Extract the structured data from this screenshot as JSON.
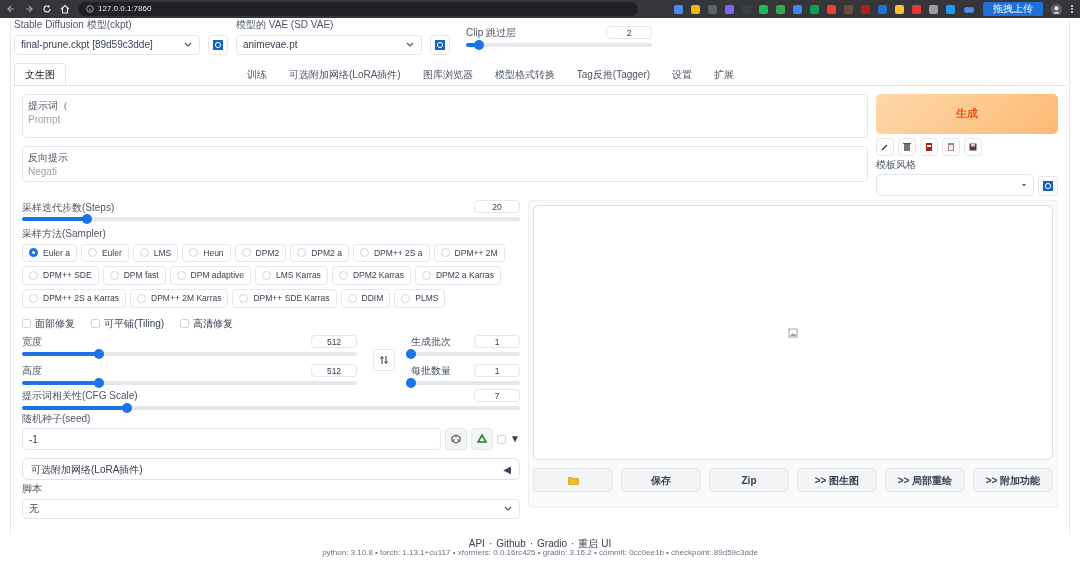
{
  "browser": {
    "address": "127.0.0.1:7860",
    "upload_button": "拖拽上传"
  },
  "top_settings": {
    "checkpoint": {
      "label": "Stable Diffusion 模型(ckpt)",
      "value": "final-prune.ckpt [89d59c3dde]"
    },
    "vae": {
      "label": "模型的 VAE (SD VAE)",
      "value": "animevae.pt"
    },
    "clip": {
      "label": "Clip 跳过层",
      "value": "2",
      "level": 0.07
    }
  },
  "tabs": [
    {
      "label": "文生图",
      "selected": true
    },
    {
      "label": "训练",
      "selected": false
    },
    {
      "label": "可选附加网络(LoRA插件)",
      "selected": false
    },
    {
      "label": "图库浏览器",
      "selected": false
    },
    {
      "label": "模型格式转换",
      "selected": false
    },
    {
      "label": "Tag反推(Tagger)",
      "selected": false
    },
    {
      "label": "设置",
      "selected": false
    },
    {
      "label": "扩展",
      "selected": false
    }
  ],
  "prompt": {
    "label": "提示词（",
    "sublabel": "Prompt"
  },
  "negative_prompt": {
    "label": "反向提示",
    "sublabel": "Negati"
  },
  "generate_button": "生成",
  "style": {
    "label": "模板风格"
  },
  "steps": {
    "label": "采样迭代步数(Steps)",
    "value": "20",
    "level": 0.13
  },
  "sampler": {
    "label": "采样方法(Sampler)",
    "options": [
      {
        "label": "Euler a",
        "selected": true
      },
      {
        "label": "Euler",
        "selected": false
      },
      {
        "label": "LMS",
        "selected": false
      },
      {
        "label": "Heun",
        "selected": false
      },
      {
        "label": "DPM2",
        "selected": false
      },
      {
        "label": "DPM2 a",
        "selected": false
      },
      {
        "label": "DPM++ 2S a",
        "selected": false
      },
      {
        "label": "DPM++ 2M",
        "selected": false
      },
      {
        "label": "DPM++ SDE",
        "selected": false
      },
      {
        "label": "DPM fast",
        "selected": false
      },
      {
        "label": "DPM adaptive",
        "selected": false
      },
      {
        "label": "LMS Karras",
        "selected": false
      },
      {
        "label": "DPM2 Karras",
        "selected": false
      },
      {
        "label": "DPM2 a Karras",
        "selected": false
      },
      {
        "label": "DPM++ 2S a Karras",
        "selected": false
      },
      {
        "label": "DPM++ 2M Karras",
        "selected": false
      },
      {
        "label": "DPM++ SDE Karras",
        "selected": false
      },
      {
        "label": "DDIM",
        "selected": false
      },
      {
        "label": "PLMS",
        "selected": false
      }
    ]
  },
  "options": [
    {
      "label": "面部修复",
      "checked": false
    },
    {
      "label": "可平铺(Tiling)",
      "checked": false
    },
    {
      "label": "高清修复",
      "checked": false
    }
  ],
  "width": {
    "label": "宽度",
    "value": "512",
    "level": 0.23
  },
  "height": {
    "label": "高度",
    "value": "512",
    "level": 0.23
  },
  "batch_count": {
    "label": "生成批次",
    "value": "1",
    "level": 0
  },
  "batch_size": {
    "label": "每批数量",
    "value": "1",
    "level": 0
  },
  "cfg_scale": {
    "label": "提示词相关性(CFG Scale)",
    "value": "7",
    "level": 0.21
  },
  "seed": {
    "label": "随机种子(seed)",
    "value": "-1",
    "extra_checked": false,
    "extra_arrow": "▼"
  },
  "lora_panel": {
    "title": "可选附加网络(LoRA插件)",
    "arrow": "◀"
  },
  "script": {
    "label": "脚本",
    "value": "无"
  },
  "output_buttons": [
    {
      "kind": "icon"
    },
    {
      "kind": "text",
      "label": "保存"
    },
    {
      "kind": "text",
      "label": "Zip"
    },
    {
      "kind": "text",
      "label": ">> 图生图"
    },
    {
      "kind": "text",
      "label": ">> 局部重绘"
    },
    {
      "kind": "text",
      "label": ">> 附加功能"
    }
  ],
  "footer": {
    "links": [
      "API",
      "Github",
      "Gradio",
      "重启 UI"
    ],
    "separator": "·",
    "versions": "python: 3.10.8  •  torch: 1.13.1+cu117  •  xformers: 0.0.16rc425  •  gradio: 3.16.2  •  commit: 0cc0ee1b  •  checkpoint: 89d59c3dde"
  }
}
